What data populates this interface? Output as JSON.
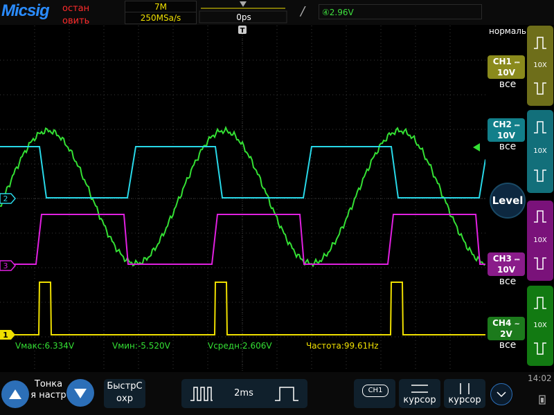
{
  "header": {
    "logo": "Micsig",
    "run_status": "остан овить",
    "memory_depth": "7M",
    "sample_rate": "250MSa/s",
    "trigger_time": "0ps",
    "trigger_slope_icon": "rising-edge-icon",
    "trigger_level": "④2.96V"
  },
  "right_panel": {
    "trigger_mode": "нормаль",
    "channels": [
      {
        "name": "CH1",
        "coupling": "DC",
        "scale": "10V",
        "bandwidth": "все",
        "probe": "10X",
        "color": "#b7b72c"
      },
      {
        "name": "CH2",
        "coupling": "DC",
        "scale": "10V",
        "bandwidth": "все",
        "probe": "10X",
        "color": "#1fc7d6"
      },
      {
        "name": "CH3",
        "coupling": "DC",
        "scale": "10V",
        "bandwidth": "все",
        "probe": "10X",
        "color": "#d21fd2"
      },
      {
        "name": "CH4",
        "coupling": "AC",
        "scale": "2V",
        "bandwidth": "все",
        "probe": "10X",
        "color": "#2bcf2b"
      }
    ],
    "level_label": "Level"
  },
  "measurements": {
    "vmax": "Vмакс:6.334V",
    "vmin": "Vмин:-5.520V",
    "vavg": "Vсредн:2.606V",
    "freq": "Частота:99.61Hz"
  },
  "markers": {
    "ch1": "1",
    "ch2": "2",
    "ch3": "3"
  },
  "bottom": {
    "fine_label": "Тонка я настр",
    "quick_save_label": "БыстрС охр",
    "timebase": "2ms",
    "channel_badge": "CH1",
    "cursor1_label": "курсор",
    "cursor2_label": "курсор",
    "clock": "14:02"
  },
  "colors": {
    "ch1": "#f0e000",
    "ch2": "#28d8e8",
    "ch3": "#e020e0",
    "ch4": "#34e034",
    "grid": "#3a3a3a"
  }
}
